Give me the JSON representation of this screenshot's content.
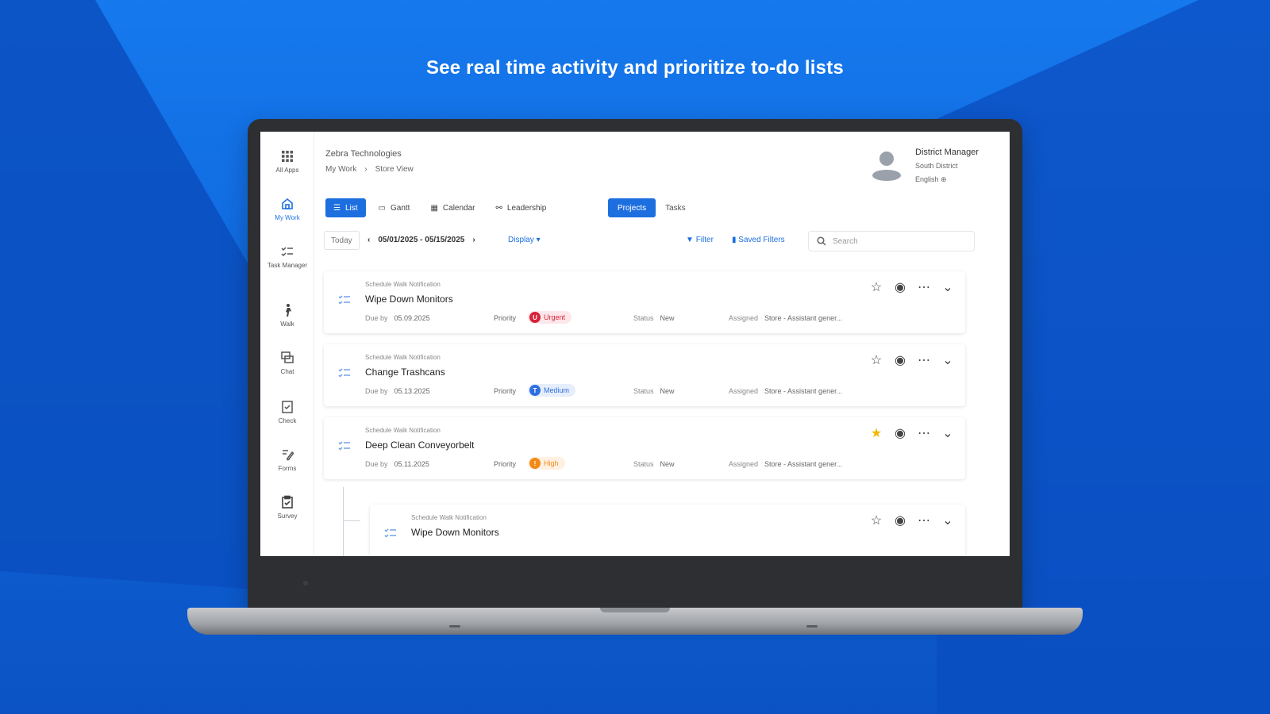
{
  "headline": "See real time activity and prioritize to-do lists",
  "colors": {
    "accent": "#1d6fe0",
    "urgent": "#d9213a",
    "medium": "#2f6fe0",
    "high": "#f28a1a",
    "star": "#f2b705"
  },
  "sidebar": {
    "items": [
      {
        "label": "All Apps",
        "icon": "grid-icon"
      },
      {
        "label": "My Work",
        "icon": "home-icon",
        "active": true
      },
      {
        "label": "Task Manager",
        "icon": "task-list-icon"
      },
      {
        "label": "Walk",
        "icon": "walk-icon"
      },
      {
        "label": "Chat",
        "icon": "chat-icon"
      },
      {
        "label": "Check",
        "icon": "checklist-icon"
      },
      {
        "label": "Forms",
        "icon": "forms-icon"
      },
      {
        "label": "Survey",
        "icon": "survey-icon"
      }
    ]
  },
  "header": {
    "org": "Zebra Technologies",
    "breadcrumb": [
      "My Work",
      "Store View"
    ],
    "user": {
      "role": "District Manager",
      "district": "South District",
      "language": "English"
    }
  },
  "toolbar": {
    "views": [
      {
        "label": "List",
        "icon": "list-icon",
        "active": true
      },
      {
        "label": "Gantt",
        "icon": "gantt-icon"
      },
      {
        "label": "Calendar",
        "icon": "calendar-icon"
      },
      {
        "label": "Leadership",
        "icon": "hierarchy-icon"
      }
    ],
    "toggle": [
      {
        "label": "Projects",
        "active": true
      },
      {
        "label": "Tasks"
      }
    ],
    "today": "Today",
    "range": "05/01/2025 - 05/15/2025",
    "display": "Display",
    "filter": "Filter",
    "saved_filters": "Saved Filters",
    "search_placeholder": "Search"
  },
  "tasks": [
    {
      "type": "Schedule Walk Notification",
      "title": "Wipe Down Monitors",
      "due_label": "Due by",
      "due": "05.09.2025",
      "priority_label": "Priority",
      "priority": "Urgent",
      "priority_letter": "U",
      "status_label": "Status",
      "status": "New",
      "assigned_label": "Assigned",
      "assigned": "Store - Assistant gener...",
      "starred": false
    },
    {
      "type": "Schedule Walk Notification",
      "title": "Change Trashcans",
      "due_label": "Due by",
      "due": "05.13.2025",
      "priority_label": "Priority",
      "priority": "Medium",
      "priority_letter": "T",
      "status_label": "Status",
      "status": "New",
      "assigned_label": "Assigned",
      "assigned": "Store - Assistant gener...",
      "starred": false
    },
    {
      "type": "Schedule Walk Notification",
      "title": "Deep Clean Conveyorbelt",
      "due_label": "Due by",
      "due": "05.11.2025",
      "priority_label": "Priority",
      "priority": "High",
      "priority_letter": "!",
      "status_label": "Status",
      "status": "New",
      "assigned_label": "Assigned",
      "assigned": "Store - Assistant gener...",
      "starred": true
    },
    {
      "type": "Schedule Walk Notification",
      "title": "Wipe Down Monitors"
    }
  ]
}
